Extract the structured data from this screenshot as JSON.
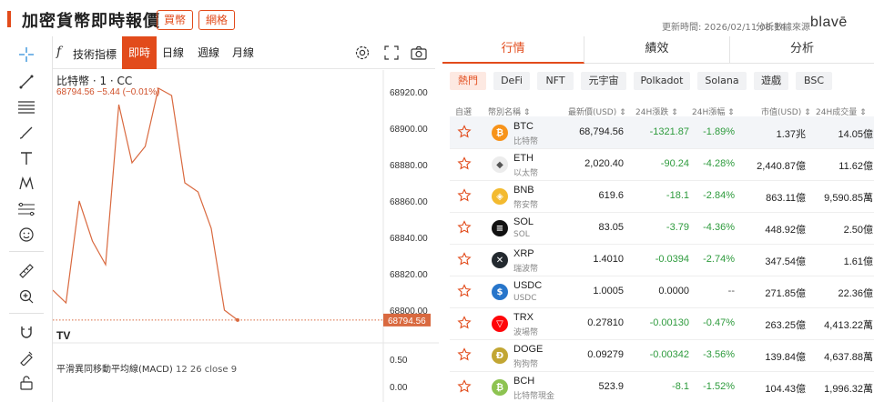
{
  "header": {
    "title": "加密貨幣即時報價",
    "buy_label": "買幣",
    "ranking_label": "網格",
    "update_time": "更新時間: 2026/02/11 08:14",
    "data_source": "分析數據來源",
    "logo_text": "blavē"
  },
  "chart_toolbar": {
    "fx_label": "f",
    "indicator_label": "技術指標",
    "ranges": [
      "即時",
      "日線",
      "週線",
      "月線"
    ],
    "active_range": "即時"
  },
  "chart": {
    "legend_title": "比特幣 · 1 · CC",
    "legend_values": "68794.56  −5.44 (−0.01%)",
    "macd_label": "平滑異同移動平均線(MACD)",
    "macd_params": "12 26 close 9",
    "tv_logo": "TV",
    "current_price_tag": "68794.56",
    "line_color": "#d9693f"
  },
  "chart_data": {
    "type": "line",
    "title": "比特幣 · 1 · CC",
    "y_ticks": [
      "68920.00",
      "68900.00",
      "68880.00",
      "68860.00",
      "68840.00",
      "68820.00",
      "68800.00"
    ],
    "ylim": [
      68794,
      68930
    ],
    "series": [
      {
        "name": "",
        "values": [
          68811,
          68804,
          68860,
          68838,
          68825,
          68913,
          68881,
          68890,
          68922,
          68918,
          68870,
          68865,
          68845,
          68800,
          68794.56
        ]
      }
    ],
    "macd_ticks": [
      "0.50",
      "0.00"
    ]
  },
  "panel": {
    "tabs": [
      "行情",
      "績效",
      "分析"
    ],
    "active_tab": "行情",
    "chips": [
      "熱門",
      "DeFi",
      "NFT",
      "元宇宙",
      "Polkadot",
      "Solana",
      "遊戲",
      "BSC"
    ],
    "active_chip": "熱門",
    "columns": [
      "自選",
      "幣別名稱 ⇕",
      "最新價(USD) ⇕",
      "24H漲跌 ⇕",
      "24H漲幅 ⇕",
      "市值(USD) ⇕",
      "24H成交量 ⇕"
    ],
    "rows": [
      {
        "sym": "BTC",
        "cn": "比特幣",
        "price": "68,794.56",
        "chg": "-1321.87",
        "pct": "-1.89%",
        "cap": "1.37兆",
        "vol": "14.05億",
        "icon": "btc-icon",
        "color": "#f7931a",
        "glyph": "₿"
      },
      {
        "sym": "ETH",
        "cn": "以太幣",
        "price": "2,020.40",
        "chg": "-90.24",
        "pct": "-4.28%",
        "cap": "2,440.87億",
        "vol": "11.62億",
        "icon": "eth-icon",
        "color": "#ececec",
        "glyph": "◆"
      },
      {
        "sym": "BNB",
        "cn": "幣安幣",
        "price": "619.6",
        "chg": "-18.1",
        "pct": "-2.84%",
        "cap": "863.11億",
        "vol": "9,590.85萬",
        "icon": "bnb-icon",
        "color": "#f3ba2f",
        "glyph": "◈"
      },
      {
        "sym": "SOL",
        "cn": "SOL",
        "price": "83.05",
        "chg": "-3.79",
        "pct": "-4.36%",
        "cap": "448.92億",
        "vol": "2.50億",
        "icon": "sol-icon",
        "color": "#111111",
        "glyph": "≡"
      },
      {
        "sym": "XRP",
        "cn": "瑞波幣",
        "price": "1.4010",
        "chg": "-0.0394",
        "pct": "-2.74%",
        "cap": "347.54億",
        "vol": "1.61億",
        "icon": "xrp-icon",
        "color": "#23292f",
        "glyph": "✕"
      },
      {
        "sym": "USDC",
        "cn": "USDC",
        "price": "1.0005",
        "chg": "0.0000",
        "pct": "--",
        "cap": "271.85億",
        "vol": "22.36億",
        "icon": "usdc-icon",
        "color": "#2775ca",
        "glyph": "$"
      },
      {
        "sym": "TRX",
        "cn": "波場幣",
        "price": "0.27810",
        "chg": "-0.00130",
        "pct": "-0.47%",
        "cap": "263.25億",
        "vol": "4,413.22萬",
        "icon": "trx-icon",
        "color": "#ff060a",
        "glyph": "▽"
      },
      {
        "sym": "DOGE",
        "cn": "狗狗幣",
        "price": "0.09279",
        "chg": "-0.00342",
        "pct": "-3.56%",
        "cap": "139.84億",
        "vol": "4,637.88萬",
        "icon": "doge-icon",
        "color": "#c2a633",
        "glyph": "Ð"
      },
      {
        "sym": "BCH",
        "cn": "比特幣現金",
        "price": "523.9",
        "chg": "-8.1",
        "pct": "-1.52%",
        "cap": "104.43億",
        "vol": "1,996.32萬",
        "icon": "bch-icon",
        "color": "#8dc351",
        "glyph": "₿"
      }
    ]
  }
}
